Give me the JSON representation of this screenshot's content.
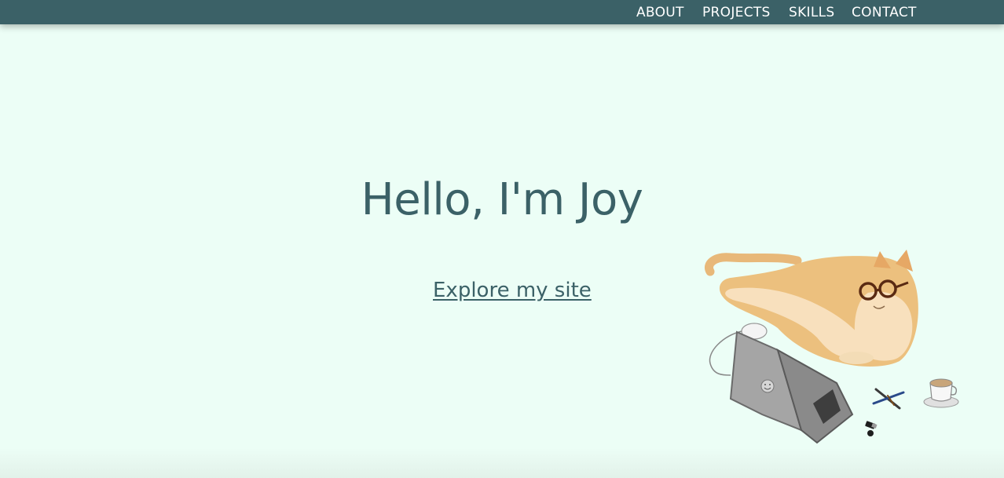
{
  "nav": {
    "items": [
      {
        "label": "ABOUT"
      },
      {
        "label": "PROJECTS"
      },
      {
        "label": "SKILLS"
      },
      {
        "label": "CONTACT"
      }
    ]
  },
  "hero": {
    "title": "Hello, I'm Joy",
    "cta_label": "Explore my site"
  },
  "colors": {
    "background": "#ecfef6",
    "primary": "#3b6167",
    "nav_text": "#ffffff"
  },
  "illustration": {
    "icons": [
      "cat-with-glasses-icon",
      "laptop-icon",
      "mouse-icon",
      "coffee-cup-icon",
      "pens-icon",
      "usb-drive-icon"
    ]
  }
}
